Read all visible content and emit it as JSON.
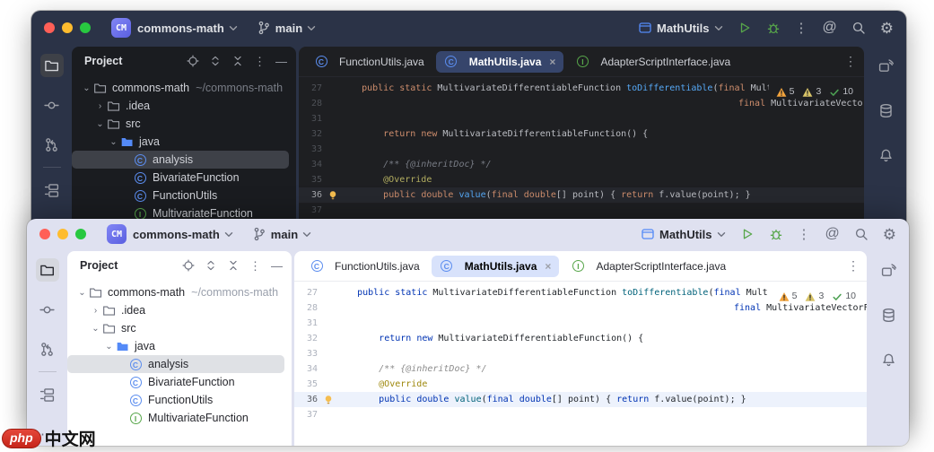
{
  "titlebar": {
    "project_badge": "CM",
    "project_name": "commons-math",
    "branch_name": "main",
    "run_config": "MathUtils"
  },
  "project_panel": {
    "title": "Project",
    "tree": [
      {
        "label": "commons-math",
        "hint": "~/commons-math",
        "icon": "folder",
        "depth": 0,
        "expander": "open"
      },
      {
        "label": ".idea",
        "icon": "folder",
        "depth": 1,
        "expander": "closed"
      },
      {
        "label": "src",
        "icon": "folder",
        "depth": 1,
        "expander": "open"
      },
      {
        "label": "java",
        "icon": "folder-blue",
        "depth": 2,
        "expander": "open"
      },
      {
        "label": "analysis",
        "icon": "class",
        "depth": 3,
        "selected": true
      },
      {
        "label": "BivariateFunction",
        "icon": "class",
        "depth": 3
      },
      {
        "label": "FunctionUtils",
        "icon": "class",
        "depth": 3
      },
      {
        "label": "MultivariateFunction",
        "icon": "interface",
        "depth": 3
      }
    ]
  },
  "tabs": [
    {
      "label": "FunctionUtils.java",
      "icon": "class",
      "active": false
    },
    {
      "label": "MathUtils.java",
      "icon": "class",
      "active": true,
      "closable": true
    },
    {
      "label": "AdapterScriptInterface.java",
      "icon": "interface",
      "active": false
    }
  ],
  "editor": {
    "inspections": {
      "warnings": "5",
      "weak_warnings": "3",
      "passed": "10"
    },
    "lines": [
      {
        "no": "27",
        "widget": true,
        "tokens": [
          [
            "pl",
            "    "
          ],
          [
            "kw",
            "public"
          ],
          [
            "pl",
            " "
          ],
          [
            "kw",
            "static"
          ],
          [
            "pl",
            " MultivariateDifferentiableFunction "
          ],
          [
            "fn",
            "toDifferentiable"
          ],
          [
            "pl",
            "("
          ],
          [
            "kw",
            "final"
          ],
          [
            "pl",
            " Mult"
          ]
        ]
      },
      {
        "no": "28",
        "pad": 74,
        "tokens": [
          [
            "kw",
            "final"
          ],
          [
            "pl",
            " MultivariateVectorFu"
          ]
        ]
      },
      {
        "no": "31",
        "tokens": []
      },
      {
        "no": "32",
        "tokens": [
          [
            "pl",
            "        "
          ],
          [
            "kw",
            "return"
          ],
          [
            "pl",
            " "
          ],
          [
            "kw",
            "new"
          ],
          [
            "pl",
            " MultivariateDifferentiableFunction() {"
          ]
        ]
      },
      {
        "no": "33",
        "tokens": []
      },
      {
        "no": "34",
        "tokens": [
          [
            "cm",
            "        /** {@inheritDoc} */"
          ]
        ]
      },
      {
        "no": "35",
        "tokens": [
          [
            "an",
            "        @Override"
          ]
        ]
      },
      {
        "no": "36",
        "caret": true,
        "bulb": true,
        "tokens": [
          [
            "pl",
            "        "
          ],
          [
            "kw",
            "public"
          ],
          [
            "pl",
            " "
          ],
          [
            "kw",
            "double"
          ],
          [
            "pl",
            " "
          ],
          [
            "fn",
            "value"
          ],
          [
            "pl",
            "("
          ],
          [
            "kw",
            "final"
          ],
          [
            "pl",
            " "
          ],
          [
            "kw",
            "double"
          ],
          [
            "pl",
            "[] point) { "
          ],
          [
            "kw",
            "return"
          ],
          [
            "pl",
            " f.value(point); }"
          ]
        ]
      },
      {
        "no": "37",
        "tokens": []
      }
    ]
  },
  "watermark": {
    "logo": "php",
    "text": "中文网"
  },
  "colors": {
    "dark_titlebar": "#2b3347",
    "dark_panel": "#1a1c20",
    "dark_editor": "#1e1f22",
    "light_titlebar": "#dfe1f0",
    "accent_blue": "#548af7",
    "accent_green": "#57a64a",
    "warning_orange": "#f2a33c",
    "weak_warning_yellow": "#d8c468",
    "traffic_red": "#ff5f57",
    "traffic_yellow": "#febc2e",
    "traffic_green": "#28c840"
  }
}
